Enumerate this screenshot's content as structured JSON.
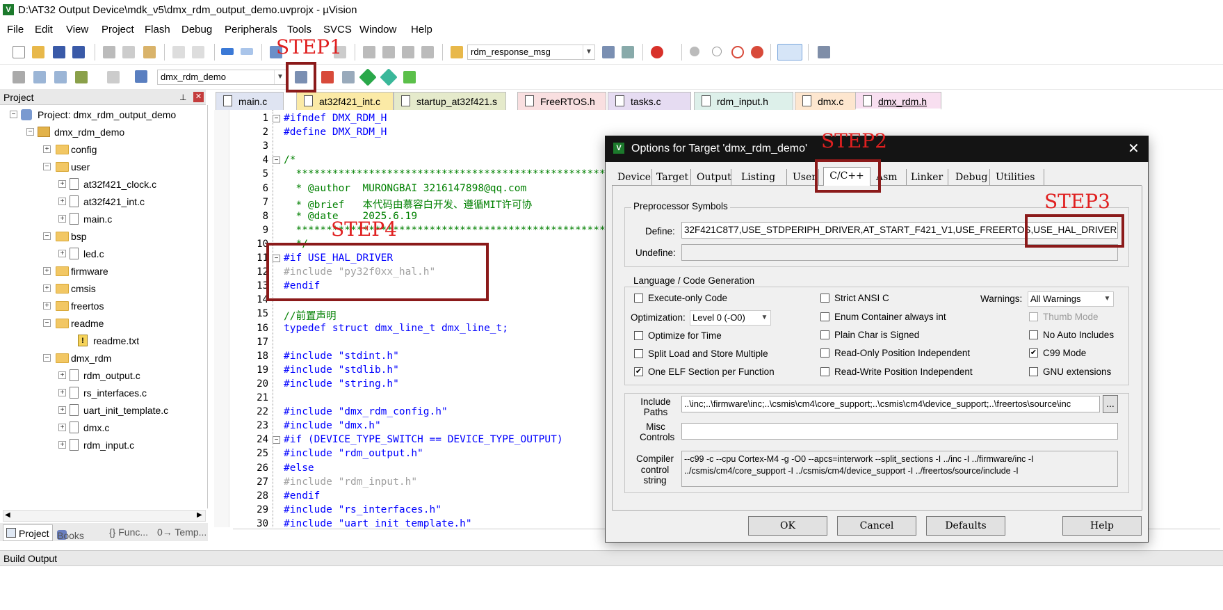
{
  "window": {
    "title": "D:\\AT32 Output Device\\mdk_v5\\dmx_rdm_output_demo.uvprojx - µVision",
    "app_icon": "V"
  },
  "menu": [
    "File",
    "Edit",
    "View",
    "Project",
    "Flash",
    "Debug",
    "Peripherals",
    "Tools",
    "SVCS",
    "Window",
    "Help"
  ],
  "toolbar1": {
    "find_combo": "rdm_response_msg"
  },
  "toolbar2": {
    "target_combo": "dmx_rdm_demo"
  },
  "project_panel": {
    "title": "Project",
    "pin_icon": "pin-icon",
    "close_icon": "close-icon",
    "tree": [
      {
        "label": "Project: dmx_rdm_output_demo",
        "level": 0,
        "kind": "project"
      },
      {
        "label": "dmx_rdm_demo",
        "level": 1,
        "kind": "target"
      },
      {
        "label": "config",
        "level": 2,
        "kind": "folder"
      },
      {
        "label": "user",
        "level": 2,
        "kind": "folder"
      },
      {
        "label": "at32f421_clock.c",
        "level": 3,
        "kind": "file"
      },
      {
        "label": "at32f421_int.c",
        "level": 3,
        "kind": "file"
      },
      {
        "label": "main.c",
        "level": 3,
        "kind": "file"
      },
      {
        "label": "bsp",
        "level": 2,
        "kind": "folder"
      },
      {
        "label": "led.c",
        "level": 3,
        "kind": "file"
      },
      {
        "label": "firmware",
        "level": 2,
        "kind": "folder"
      },
      {
        "label": "cmsis",
        "level": 2,
        "kind": "folder"
      },
      {
        "label": "freertos",
        "level": 2,
        "kind": "folder"
      },
      {
        "label": "readme",
        "level": 2,
        "kind": "folder"
      },
      {
        "label": "readme.txt",
        "level": 3,
        "kind": "warnfile"
      },
      {
        "label": "dmx_rdm",
        "level": 2,
        "kind": "folder"
      },
      {
        "label": "rdm_output.c",
        "level": 3,
        "kind": "file"
      },
      {
        "label": "rs_interfaces.c",
        "level": 3,
        "kind": "file"
      },
      {
        "label": "uart_init_template.c",
        "level": 3,
        "kind": "file"
      },
      {
        "label": "dmx.c",
        "level": 3,
        "kind": "file"
      },
      {
        "label": "rdm_input.c",
        "level": 3,
        "kind": "file"
      }
    ],
    "bottom_tabs": [
      "Project",
      "Books",
      "{} Func...",
      "0→ Temp..."
    ]
  },
  "editor_tabs": [
    {
      "label": "main.c",
      "color": "#dfe4f2"
    },
    {
      "label": "at32f421_int.c",
      "color": "#fbeaa6"
    },
    {
      "label": "startup_at32f421.s",
      "color": "#e5eacb"
    },
    {
      "label": "FreeRTOS.h",
      "color": "#f9dfe0"
    },
    {
      "label": "tasks.c",
      "color": "#e6dcf2"
    },
    {
      "label": "rdm_input.h",
      "color": "#ddf0ea"
    },
    {
      "label": "dmx.c",
      "color": "#fde6cf"
    },
    {
      "label": "dmx_rdm.h",
      "color": "#f8dff0"
    }
  ],
  "code_lines": [
    {
      "n": "1",
      "t": "#ifndef DMX_RDM_H",
      "s": "pp"
    },
    {
      "n": "2",
      "t": "#define DMX_RDM_H",
      "s": "pp"
    },
    {
      "n": "3",
      "t": "",
      "s": ""
    },
    {
      "n": "4",
      "t": "/*",
      "s": "cm"
    },
    {
      "n": "5",
      "t": "  ***************************************************",
      "s": "cm"
    },
    {
      "n": "6",
      "t": "  * @author  MURONGBAI 3216147898@qq.com",
      "s": "cm"
    },
    {
      "n": "7",
      "t": "  * @brief   本代码由慕容白开发、遵循MIT许可协",
      "s": "cm"
    },
    {
      "n": "8",
      "t": "  * @date    2025.6.19",
      "s": "cm"
    },
    {
      "n": "9",
      "t": "  ***************************************************",
      "s": "cm"
    },
    {
      "n": "10",
      "t": "  */",
      "s": "cm"
    },
    {
      "n": "11",
      "t": "#if USE_HAL_DRIVER",
      "s": "pp"
    },
    {
      "n": "12",
      "t": "#include \"py32f0xx_hal.h\"",
      "s": "dim"
    },
    {
      "n": "13",
      "t": "#endif",
      "s": "pp"
    },
    {
      "n": "14",
      "t": "",
      "s": ""
    },
    {
      "n": "15",
      "t": "//前置声明",
      "s": "cm"
    },
    {
      "n": "16",
      "t": "typedef struct dmx_line_t dmx_line_t;",
      "s": "td"
    },
    {
      "n": "17",
      "t": "",
      "s": ""
    },
    {
      "n": "18",
      "t": "#include \"stdint.h\"",
      "s": "inc"
    },
    {
      "n": "19",
      "t": "#include \"stdlib.h\"",
      "s": "inc"
    },
    {
      "n": "20",
      "t": "#include \"string.h\"",
      "s": "inc"
    },
    {
      "n": "21",
      "t": "",
      "s": ""
    },
    {
      "n": "22",
      "t": "#include \"dmx_rdm_config.h\"",
      "s": "inc"
    },
    {
      "n": "23",
      "t": "#include \"dmx.h\"",
      "s": "inc"
    },
    {
      "n": "24",
      "t": "#if (DEVICE_TYPE_SWITCH == DEVICE_TYPE_OUTPUT)",
      "s": "pp"
    },
    {
      "n": "25",
      "t": "#include \"rdm_output.h\"",
      "s": "inc"
    },
    {
      "n": "26",
      "t": "#else",
      "s": "pp"
    },
    {
      "n": "27",
      "t": "#include \"rdm_input.h\"",
      "s": "dim"
    },
    {
      "n": "28",
      "t": "#endif",
      "s": "pp"
    },
    {
      "n": "29",
      "t": "#include \"rs_interfaces.h\"",
      "s": "inc"
    },
    {
      "n": "30",
      "t": "#include \"uart_init_template.h\"",
      "s": "inc"
    }
  ],
  "build_output": {
    "title": "Build Output"
  },
  "steps": {
    "step1": "STEP1",
    "step2": "STEP2",
    "step3": "STEP3",
    "step4": "STEP4"
  },
  "dialog": {
    "title": "Options for Target 'dmx_rdm_demo'",
    "tabs": [
      "Device",
      "Target",
      "Output",
      "Listing",
      "User",
      "C/C++",
      "Asm",
      "Linker",
      "Debug",
      "Utilities"
    ],
    "active_tab": "C/C++",
    "preprocessor": {
      "group": "Preprocessor Symbols",
      "define_label": "Define:",
      "define_value": "32F421C8T7,USE_STDPERIPH_DRIVER,AT_START_F421_V1,USE_FREERTOS,USE_HAL_DRIVER",
      "undefine_label": "Undefine:",
      "undefine_value": ""
    },
    "language": {
      "group": "Language / Code Generation",
      "execute_only": {
        "label": "Execute-only Code",
        "checked": false
      },
      "optimization_label": "Optimization:",
      "optimization_value": "Level 0 (-O0)",
      "optimize_time": {
        "label": "Optimize for Time",
        "checked": false
      },
      "split_load": {
        "label": "Split Load and Store Multiple",
        "checked": false
      },
      "one_elf": {
        "label": "One ELF Section per Function",
        "checked": true
      },
      "strict_ansi": {
        "label": "Strict ANSI C",
        "checked": false
      },
      "enum_container": {
        "label": "Enum Container always int",
        "checked": false
      },
      "plain_char": {
        "label": "Plain Char is Signed",
        "checked": false
      },
      "ro_pi": {
        "label": "Read-Only Position Independent",
        "checked": false
      },
      "rw_pi": {
        "label": "Read-Write Position Independent",
        "checked": false
      },
      "warnings_label": "Warnings:",
      "warnings_value": "All Warnings",
      "thumb_mode": {
        "label": "Thumb Mode",
        "checked": false
      },
      "no_auto_includes": {
        "label": "No Auto Includes",
        "checked": false
      },
      "c99": {
        "label": "C99 Mode",
        "checked": true
      },
      "gnu_ext": {
        "label": "GNU extensions",
        "checked": false
      }
    },
    "include_paths_label": "Include\nPaths",
    "include_paths_value": "..\\inc;..\\firmware\\inc;..\\csmis\\cm4\\core_support;..\\csmis\\cm4\\device_support;..\\freertos\\source\\inc",
    "browse_label": "...",
    "misc_label": "Misc\nControls",
    "misc_value": "",
    "compiler_label": "Compiler\ncontrol\nstring",
    "compiler_value_1": "--c99 -c --cpu Cortex-M4 -g -O0 --apcs=interwork --split_sections -I ../inc -I ../firmware/inc -I",
    "compiler_value_2": "../csmis/cm4/core_support -I ../csmis/cm4/device_support -I ../freertos/source/include -I",
    "buttons": {
      "ok": "OK",
      "cancel": "Cancel",
      "defaults": "Defaults",
      "help": "Help"
    }
  }
}
